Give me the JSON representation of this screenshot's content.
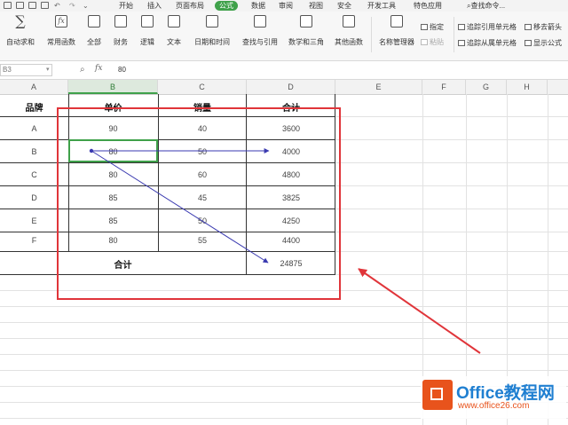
{
  "menu": {
    "tabs": [
      "开始",
      "插入",
      "页面布局",
      "公式",
      "数据",
      "审阅",
      "视图",
      "安全",
      "开发工具",
      "特色应用"
    ],
    "active_tab": "公式",
    "search": "查找命令..."
  },
  "ribbon": {
    "buttons": [
      "自动求和",
      "常用函数",
      "全部",
      "财务",
      "逻辑",
      "文本",
      "日期和时间",
      "查找与引用",
      "数学和三角",
      "其他函数",
      "名称管理器"
    ],
    "small_buttons": [
      "指定",
      "粘贴"
    ],
    "right_items": [
      "追踪引用单元格",
      "追踪从属单元格",
      "移去箭头",
      "显示公式"
    ]
  },
  "formula_bar": {
    "name_box": "B3",
    "fx": "fx",
    "value": "80"
  },
  "columns": [
    "A",
    "B",
    "C",
    "D",
    "E",
    "F",
    "G",
    "H"
  ],
  "table": {
    "headers": [
      "品牌",
      "单价",
      "销量",
      "合计"
    ],
    "rows": [
      [
        "A",
        "90",
        "40",
        "3600"
      ],
      [
        "B",
        "80",
        "50",
        "4000"
      ],
      [
        "C",
        "80",
        "60",
        "4800"
      ],
      [
        "D",
        "85",
        "45",
        "3825"
      ],
      [
        "E",
        "85",
        "50",
        "4250"
      ],
      [
        "F",
        "80",
        "55",
        "4400"
      ]
    ],
    "total_label": "合计",
    "total_value": "24875"
  },
  "colors": {
    "accent": "#3fa14a",
    "annotation": "#e0353a",
    "trace_arrow": "#3a3ab0",
    "logo_orange": "#e8531c",
    "logo_blue": "#1f7fd1"
  },
  "logo": {
    "brand": "Office教程网",
    "url": "www.office26.com"
  }
}
